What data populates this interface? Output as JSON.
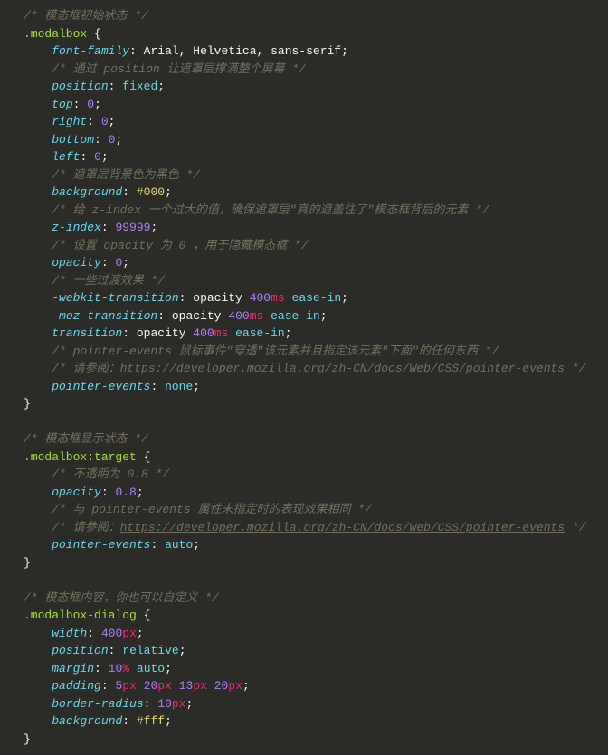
{
  "code": {
    "block1_comment": "/* 模态框初始状态 */",
    "block1_selector": ".modalbox",
    "font_family_prop": "font-family",
    "font_family_val": "Arial, Helvetica, sans-serif",
    "c_position": "/* 通过 position 让遮罩层撑满整个屏幕 */",
    "position_prop": "position",
    "position_val": "fixed",
    "top_prop": "top",
    "zero": "0",
    "right_prop": "right",
    "bottom_prop": "bottom",
    "left_prop": "left",
    "c_bg": "/* 遮罩层背景色为黑色 */",
    "bg_prop": "background",
    "bg_val": "#000",
    "c_zindex": "/* 给 z-index 一个过大的值，确保遮罩层\"真的遮盖住了\"模态框背后的元素 */",
    "zindex_prop": "z-index",
    "zindex_val": "99999",
    "c_opacity": "/* 设置 opacity 为 0 ，用于隐藏模态框 */",
    "opacity_prop": "opacity",
    "c_trans": "/* 一些过渡效果 */",
    "webkit_t": "-webkit-transition",
    "moz_t": "-moz-transition",
    "trans": "transition",
    "trans_opacity": "opacity",
    "trans_400": "400",
    "trans_ms": "ms",
    "trans_ease": "ease-in",
    "c_pe": "/* pointer-events 鼠标事件\"穿透\"该元素并且指定该元素\"下面\"的任何东西 */",
    "c_see": "/* 请参阅：",
    "url_pe": "https://developer.mozilla.org/zh-CN/docs/Web/CSS/pointer-events",
    "c_end": " */",
    "pe_prop": "pointer-events",
    "pe_none": "none",
    "block2_comment": "/* 模态框显示状态 */",
    "block2_selector": ".modalbox:target",
    "c_op08": "/* 不透明为 0.8 */",
    "op08": "0.8",
    "c_pe2": "/* 与 pointer-events 属性未指定时的表现效果相同 */",
    "pe_auto": "auto",
    "block3_comment": "/* 模态框内容，你也可以自定义 */",
    "block3_selector": ".modalbox-dialog",
    "width_prop": "width",
    "w400": "400",
    "px": "px",
    "pos_rel": "relative",
    "margin_prop": "margin",
    "m10": "10",
    "pct": "%",
    "auto": "auto",
    "padding_prop": "padding",
    "p5": "5",
    "p20": "20",
    "p13": "13",
    "br_prop": "border-radius",
    "br10": "10",
    "bg_fff": "#fff"
  }
}
